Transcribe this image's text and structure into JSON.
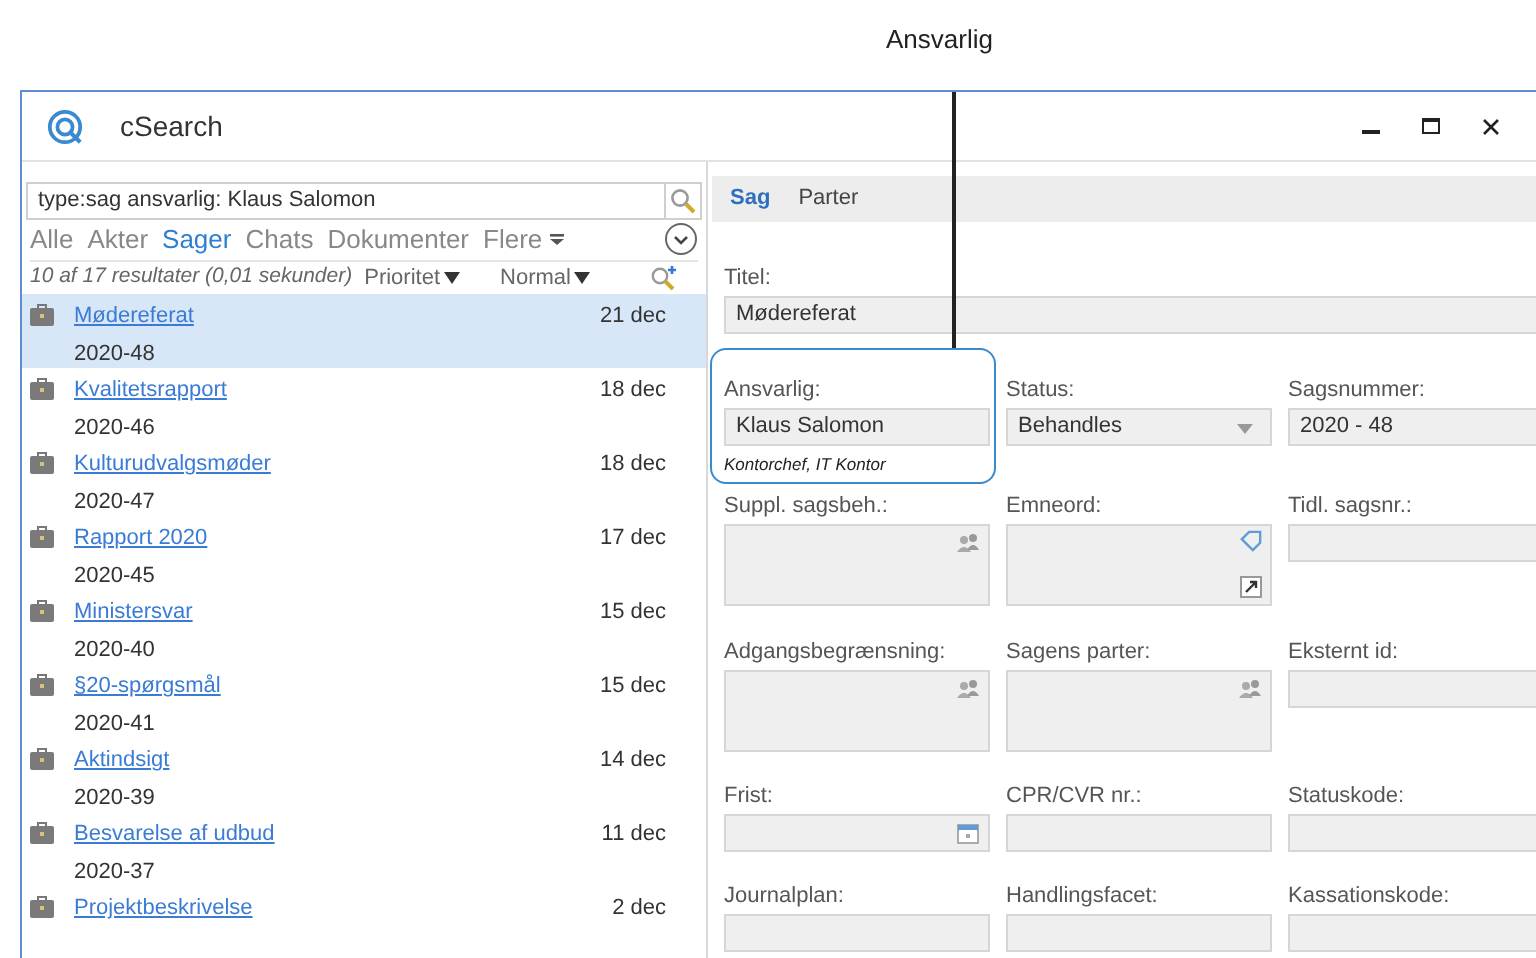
{
  "annotation": {
    "label": "Ansvarlig"
  },
  "window": {
    "title": "cSearch"
  },
  "search": {
    "value": "type:sag ansvarlig: Klaus Salomon"
  },
  "filters": [
    {
      "label": "Alle",
      "selected": false
    },
    {
      "label": "Akter",
      "selected": false
    },
    {
      "label": "Sager",
      "selected": true
    },
    {
      "label": "Chats",
      "selected": false
    },
    {
      "label": "Dokumenter",
      "selected": false
    },
    {
      "label": "Flere",
      "selected": false,
      "kind": "menu"
    }
  ],
  "summary": "10 af 17 resultater (0,01 sekunder)",
  "sort": [
    {
      "label": "Prioritet"
    },
    {
      "label": "Normal"
    }
  ],
  "results": [
    {
      "title": "Mødereferat",
      "number": "2020-48",
      "date": "21 dec",
      "selected": true
    },
    {
      "title": "Kvalitetsrapport",
      "number": "2020-46",
      "date": "18 dec",
      "selected": false
    },
    {
      "title": "Kulturudvalgsmøder",
      "number": "2020-47",
      "date": "18 dec",
      "selected": false
    },
    {
      "title": "Rapport 2020",
      "number": "2020-45",
      "date": "17 dec",
      "selected": false
    },
    {
      "title": "Ministersvar",
      "number": "2020-40",
      "date": "15 dec",
      "selected": false
    },
    {
      "title": "§20-spørgsmål",
      "number": "2020-41",
      "date": "15 dec",
      "selected": false
    },
    {
      "title": "Aktindsigt",
      "number": "2020-39",
      "date": "14 dec",
      "selected": false
    },
    {
      "title": "Besvarelse af udbud",
      "number": "2020-37",
      "date": "11 dec",
      "selected": false
    },
    {
      "title": "Projektbeskrivelse",
      "date": "2 dec",
      "selected": false
    }
  ],
  "detail_tabs": [
    {
      "label": "Sag",
      "selected": true
    },
    {
      "label": "Parter",
      "selected": false
    }
  ],
  "title_field": {
    "label": "Titel:",
    "value": "Mødereferat"
  },
  "field_rows": [
    [
      {
        "label": "Ansvarlig:",
        "kind": "text",
        "value": "Klaus Salomon",
        "note": "Kontorchef, IT Kontor",
        "highlighted": true
      },
      {
        "label": "Status:",
        "kind": "select",
        "value": "Behandles",
        "highlighted": false
      },
      {
        "label": "Sagsnummer:",
        "kind": "text",
        "value": "2020 - 48",
        "highlighted": false
      }
    ],
    [
      {
        "label": "Suppl. sagsbeh.:",
        "kind": "people",
        "highlighted": false
      },
      {
        "label": "Emneord:",
        "kind": "keywords",
        "highlighted": false
      },
      {
        "label": "Tidl. sagsnr.:",
        "kind": "text",
        "highlighted": false
      }
    ],
    [
      {
        "label": "Adgangsbegrænsning:",
        "kind": "people",
        "highlighted": false
      },
      {
        "label": "Sagens parter:",
        "kind": "people",
        "highlighted": false
      },
      {
        "label": "Eksternt id:",
        "kind": "text",
        "highlighted": false
      }
    ],
    [
      {
        "label": "Frist:",
        "kind": "date",
        "highlighted": false
      },
      {
        "label": "CPR/CVR nr.:",
        "kind": "text",
        "highlighted": false
      },
      {
        "label": "Statuskode:",
        "kind": "text",
        "highlighted": false
      }
    ],
    [
      {
        "label": "Journalplan:",
        "kind": "text",
        "highlighted": false
      },
      {
        "label": "Handlingsfacet:",
        "kind": "text",
        "highlighted": false
      },
      {
        "label": "Kassationskode:",
        "kind": "text",
        "highlighted": false
      }
    ]
  ]
}
